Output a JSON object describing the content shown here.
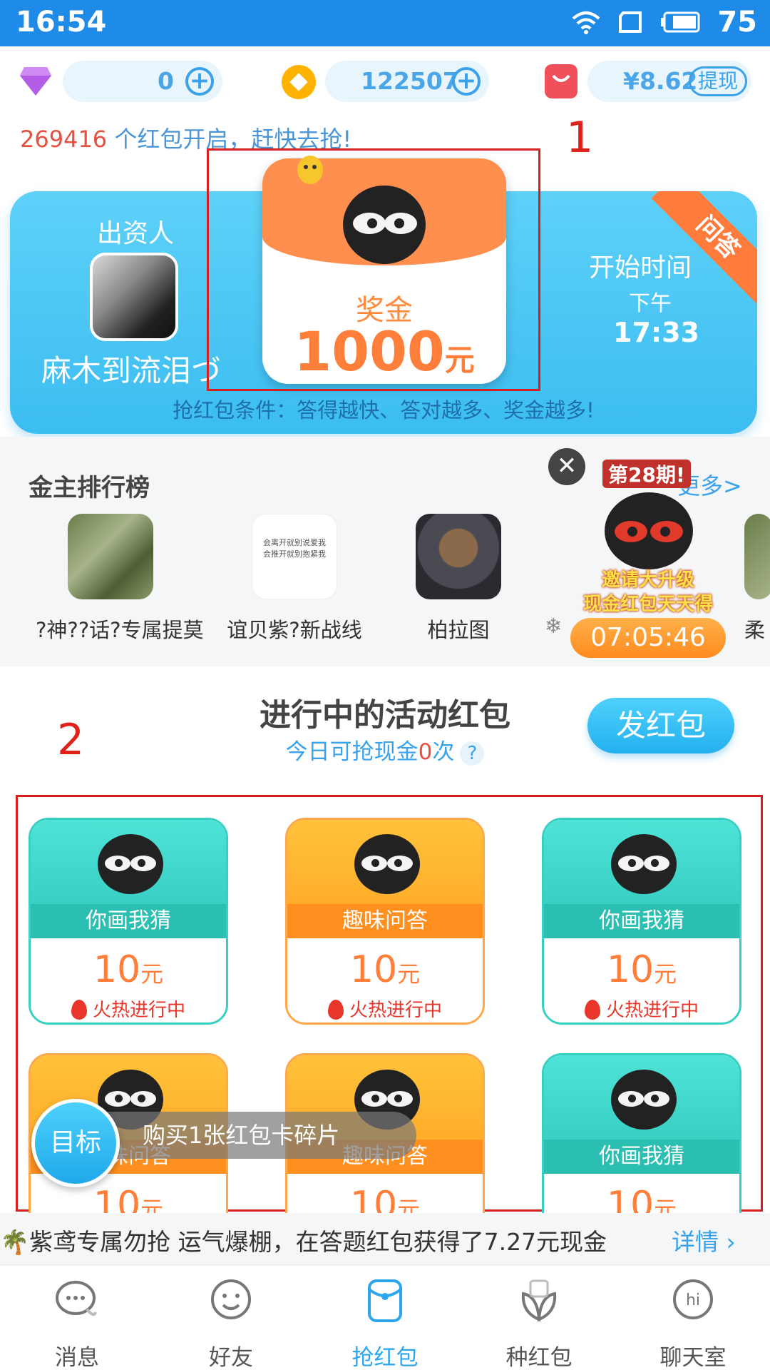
{
  "status_bar": {
    "time": "16:54",
    "battery": "75"
  },
  "currency": {
    "diamonds": "0",
    "coins": "122507",
    "cash": "¥8.62",
    "withdraw_label": "提现"
  },
  "notice": {
    "count": "269416",
    "text": " 个红包开启，赶快去抢!"
  },
  "hero": {
    "sponsor_label": "出资人",
    "sponsor_name": "麻木到流泪づ",
    "prize_label": "奖金",
    "prize_amount": "1000",
    "prize_unit": "元",
    "start_label": "开始时间",
    "start_period": "下午",
    "start_time": "17:33",
    "badge": "问答",
    "condition": "抢红包条件：答得越快、答对越多、奖金越多!"
  },
  "annotations": {
    "box1": "1",
    "box2": "2"
  },
  "ranking": {
    "title": "金主排行榜",
    "more": "更多>",
    "items": [
      {
        "name": "?神??话?专属提莫"
      },
      {
        "name": "谊贝紫?新战线"
      },
      {
        "name": "柏拉图"
      },
      {
        "name": "❄"
      },
      {
        "name": "柔"
      }
    ],
    "avatar2_lines": [
      "会离开就别说爱我",
      "会推开就别抱紧我"
    ]
  },
  "promo": {
    "issue": "第28期!",
    "line1": "邀请大升级",
    "line2": "现金红包天天得",
    "timer": "07:05:46"
  },
  "activity": {
    "title": "进行中的活动红包",
    "sub_prefix": "今日可抢现金",
    "sub_count": "0",
    "sub_suffix": "次",
    "help": "?",
    "send_button": "发红包",
    "cards": [
      {
        "label": "你画我猜",
        "amount": "10",
        "unit": "元",
        "status": "火热进行中",
        "theme": "teal"
      },
      {
        "label": "趣味问答",
        "amount": "10",
        "unit": "元",
        "status": "火热进行中",
        "theme": "orange"
      },
      {
        "label": "你画我猜",
        "amount": "10",
        "unit": "元",
        "status": "火热进行中",
        "theme": "teal"
      },
      {
        "label": "趣味问答",
        "amount": "10",
        "unit": "元",
        "status": "",
        "theme": "orange"
      },
      {
        "label": "趣味问答",
        "amount": "10",
        "unit": "元",
        "status": "",
        "theme": "orange"
      },
      {
        "label": "你画我猜",
        "amount": "10",
        "unit": "元",
        "status": "",
        "theme": "teal"
      }
    ]
  },
  "goal": {
    "button": "目标",
    "text": "购买1张红包卡碎片"
  },
  "ticker": {
    "text": "🌴紫鸢专属勿抢  运气爆棚，在答题红包获得了7.27元现金",
    "detail": "详情"
  },
  "tabs": [
    {
      "label": "消息",
      "icon": "message-icon"
    },
    {
      "label": "好友",
      "icon": "friend-icon"
    },
    {
      "label": "抢红包",
      "icon": "red-packet-icon"
    },
    {
      "label": "种红包",
      "icon": "plant-icon"
    },
    {
      "label": "聊天室",
      "icon": "chatroom-icon"
    }
  ],
  "colors": {
    "accent": "#2ea6ee",
    "orange": "#ff8f4f",
    "teal": "#39d3c9",
    "red": "#e84f3f"
  }
}
